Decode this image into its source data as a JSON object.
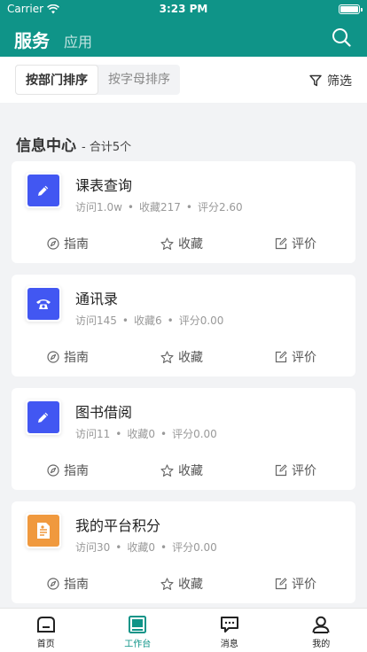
{
  "status": {
    "carrier": "Carrier",
    "time": "3:23 PM"
  },
  "header": {
    "tab_active": "服务",
    "tab_inactive": "应用"
  },
  "sort": {
    "by_department": "按部门排序",
    "by_letter": "按字母排序",
    "filter": "筛选"
  },
  "section": {
    "title": "信息中心",
    "count": "- 合计5个"
  },
  "actions": {
    "guide": "指南",
    "favorite": "收藏",
    "rate": "评价"
  },
  "colors": {
    "brand": "#0f9488",
    "icon_blue": "#4257f2",
    "icon_orange": "#f0993e"
  },
  "services": [
    {
      "name": "课表查询",
      "visits": "访问1.0w",
      "favorites": "收藏217",
      "rating": "评分2.60",
      "icon": "pencil-icon",
      "color": "#4257f2"
    },
    {
      "name": "通讯录",
      "visits": "访问145",
      "favorites": "收藏6",
      "rating": "评分0.00",
      "icon": "phone-icon",
      "color": "#4257f2"
    },
    {
      "name": "图书借阅",
      "visits": "访问11",
      "favorites": "收藏0",
      "rating": "评分0.00",
      "icon": "pencil-icon",
      "color": "#4257f2"
    },
    {
      "name": "我的平台积分",
      "visits": "访问30",
      "favorites": "收藏0",
      "rating": "评分0.00",
      "icon": "document-icon",
      "color": "#f0993e"
    }
  ],
  "tabbar": [
    {
      "label": "首页",
      "icon": "home-icon"
    },
    {
      "label": "工作台",
      "icon": "workbench-icon"
    },
    {
      "label": "消息",
      "icon": "message-icon"
    },
    {
      "label": "我的",
      "icon": "profile-icon"
    }
  ]
}
